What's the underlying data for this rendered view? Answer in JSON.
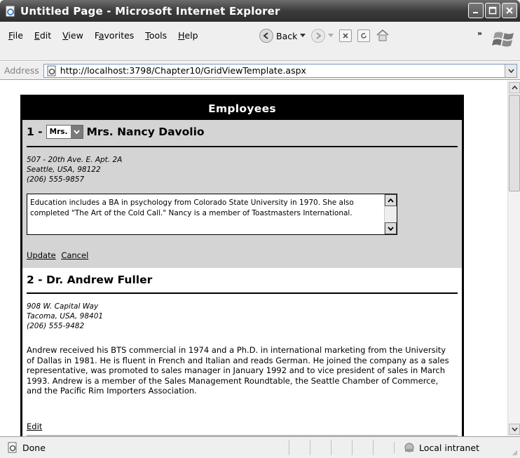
{
  "window": {
    "title": "Untitled Page - Microsoft Internet Explorer"
  },
  "menu": {
    "items": [
      {
        "pre": "",
        "key": "F",
        "post": "ile"
      },
      {
        "pre": "",
        "key": "E",
        "post": "dit"
      },
      {
        "pre": "",
        "key": "V",
        "post": "iew"
      },
      {
        "pre": "F",
        "key": "a",
        "post": "vorites"
      },
      {
        "pre": "",
        "key": "T",
        "post": "ools"
      },
      {
        "pre": "",
        "key": "H",
        "post": "elp"
      }
    ]
  },
  "toolbar": {
    "back_label": "Back",
    "chevron": "»"
  },
  "address": {
    "label": "Address",
    "url": "http://localhost:3798/Chapter10/GridViewTemplate.aspx"
  },
  "grid": {
    "header": "Employees",
    "edit_record": {
      "index_prefix": "1 -",
      "title_select_value": "Mrs.",
      "name": "Mrs. Nancy Davolio",
      "address_lines": [
        "507 - 20th Ave. E. Apt. 2A",
        "Seattle, USA, 98122",
        "(206) 555-9857"
      ],
      "notes": "Education includes a BA in psychology from Colorado State University in 1970.  She also completed \"The Art of the Cold Call.\"  Nancy is a member of Toastmasters International.",
      "update_label": "Update",
      "cancel_label": "Cancel"
    },
    "view_record": {
      "title": "2 - Dr. Andrew Fuller",
      "address_lines": [
        "908 W. Capital Way",
        "Tacoma, USA, 98401",
        "(206) 555-9482"
      ],
      "notes": "Andrew received his BTS commercial in 1974 and a Ph.D. in international marketing from the University of Dallas in 1981. He is fluent in French and Italian and reads German. He joined the company as a sales representative, was promoted to sales manager in January 1992 and to vice president of sales in March 1993. Andrew is a member of the Sales Management Roundtable, the Seattle Chamber of Commerce, and the Pacific Rim Importers Association.",
      "edit_label": "Edit"
    }
  },
  "status": {
    "text": "Done",
    "zone": "Local intranet"
  }
}
